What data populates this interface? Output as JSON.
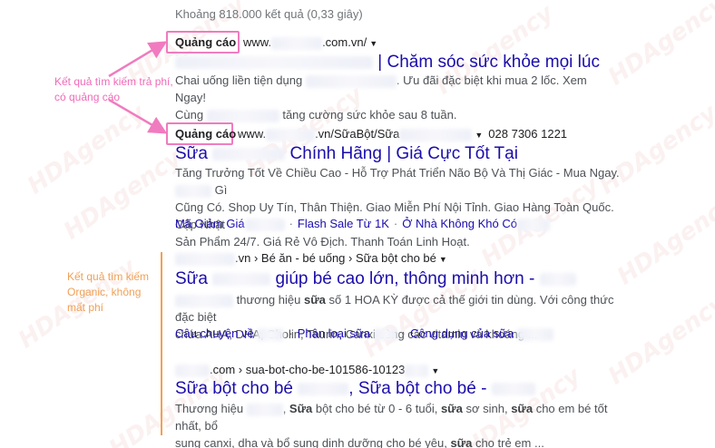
{
  "results_stats": "Khoảng 818.000 kết quả (0,33 giây)",
  "watermark": "HDAgency",
  "colors": {
    "ad_highlight": "#f07bbf",
    "organic_highlight": "#f4a050",
    "link": "#1a0dab"
  },
  "annotations": {
    "ad_label": "Kết quả tìm kiếm trả phí, có quảng cáo",
    "organic_label": "Kết quả tìm kiếm Organic, không mất phí"
  },
  "ads": [
    {
      "badge": "Quảng cáo",
      "url": "www.",
      "url_suffix": ".com.vn/",
      "title": "| Chăm sóc sức khỏe mọi lúc",
      "desc_line1_a": "Chai uống liền tiện dụng",
      "desc_line1_b": ". Ưu đãi đặc biệt khi mua 2 lốc. Xem Ngay!",
      "desc_line2_a": "Cùng",
      "desc_line2_b": "tăng cường sức khỏe sau 8 tuần."
    },
    {
      "badge": "Quảng cáo",
      "url": "www.",
      "url_suffix": ".vn/SữaBột/Sữa",
      "phone": "028 7306 1221",
      "title_a": "Sữa",
      "title_b": "Chính Hãng | Giá Cực Tốt Tại",
      "desc_line1_a": "Tăng Trưởng Tốt Về Chiều Cao - Hỗ Trợ Phát Triển Não Bộ Và Thị Giác - Mua Ngay.",
      "desc_line1_b": "Gì",
      "desc_line2": "Cũng Có. Shop Uy Tín, Thân Thiện. Giao Miễn Phí Nội Tỉnh. Giao Hàng Toàn Quốc. Cập Nhật",
      "desc_line3": "Sản Phẩm 24/7. Giá Rẻ Vô Địch. Thanh Toán Linh Hoạt.",
      "sitelinks": [
        "Mã Giảm Giá",
        "Flash Sale Từ 1K",
        "Ở Nhà Không Khó Có"
      ]
    }
  ],
  "organic": [
    {
      "breadcrumb": ".vn › Bé ăn - bé uống › Sữa bột cho bé",
      "title_a": "Sữa",
      "title_b": "giúp bé cao lớn, thông minh hơn -",
      "desc_line1_a": "thương hiệu",
      "desc_line1_bold": "sữa",
      "desc_line1_b": "số 1 HOA KỲ được cả thế giới tin dùng. Với công thức đặc biệt",
      "desc_line2": "chứa AHA, DHA, Cholin, Taurin, Canxi cùng các vitamin và khoáng ...",
      "sitelinks": [
        "Câu chuyện về",
        "Phân loại sữa",
        "Công dụng của sữa"
      ]
    },
    {
      "breadcrumb": ".com › sua-bot-cho-be-101586-10123",
      "title_a": "Sữa bột cho bé",
      "title_b": ", Sữa bột cho bé -",
      "desc_line1_a": "Thương hiệu",
      "desc_line1_bold1": "Sữa",
      "desc_line1_b": "bột cho bé từ 0 - 6 tuổi,",
      "desc_line1_bold2": "sữa",
      "desc_line1_c": "sơ sinh,",
      "desc_line1_bold3": "sữa",
      "desc_line1_d": "cho em bé tốt nhất, bổ",
      "desc_line2_a": "sung canxi, dha và bổ sung dinh dưỡng cho bé yêu,",
      "desc_line2_bold": "sữa",
      "desc_line2_b": "cho trẻ em ..."
    }
  ]
}
